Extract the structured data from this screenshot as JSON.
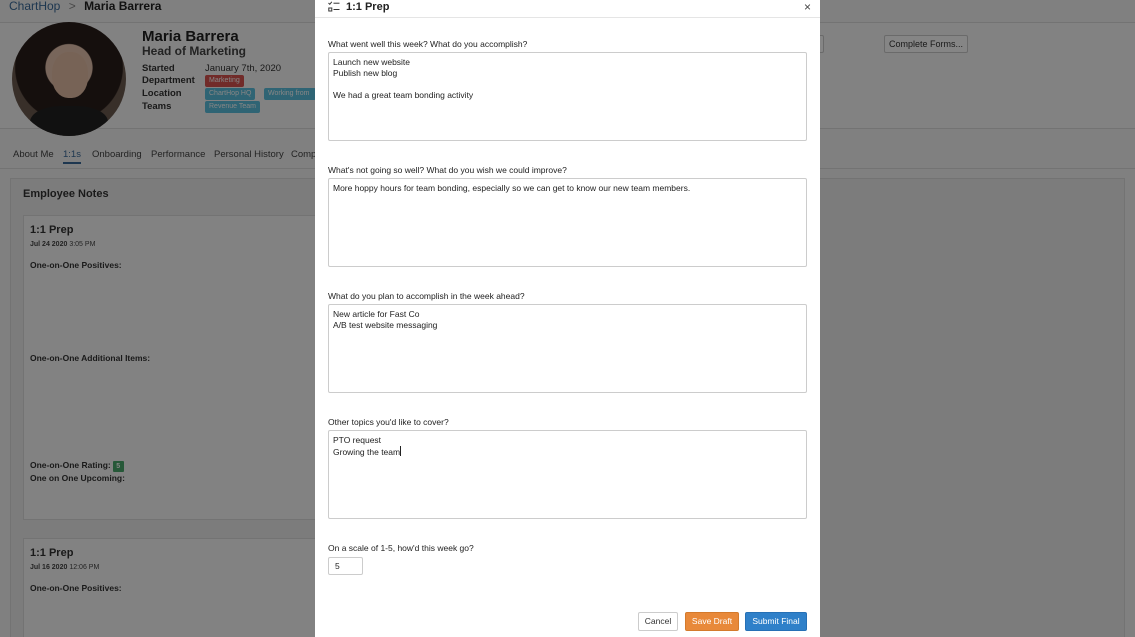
{
  "breadcrumb": {
    "app": "ChartHop",
    "separator": ">",
    "current": "Maria Barrera"
  },
  "profile": {
    "name": "Maria Barrera",
    "title": "Head of Marketing",
    "fields": [
      {
        "label": "Started",
        "value": "January 7th, 2020"
      },
      {
        "label": "Department"
      },
      {
        "label": "Location"
      },
      {
        "label": "Teams"
      }
    ],
    "department_chip": "Marketing",
    "location_chips": [
      "ChartHop HQ",
      "Working from"
    ],
    "teams_chip": "Revenue Team",
    "complete_forms_button": "Complete Forms..."
  },
  "tabs": [
    "About Me",
    "1:1s",
    "Onboarding",
    "Performance",
    "Personal History",
    "Comp"
  ],
  "active_tab": "1:1s",
  "notes": {
    "title": "Employee Notes",
    "cards": [
      {
        "title": "1:1 Prep",
        "date": "Jul 24 2020",
        "time": "3:05 PM",
        "positives_label": "One-on-One Positives:",
        "additional_label": "One-on-One Additional Items:",
        "rating_label": "One-on-One Rating:",
        "rating_value": "5",
        "upcoming_label": "One on One Upcoming:"
      },
      {
        "title": "1:1 Prep",
        "date": "Jul 16 2020",
        "time": "12:06 PM",
        "positives_label": "One-on-One Positives:"
      }
    ]
  },
  "modal": {
    "icon": "checklist-icon",
    "title": "1:1 Prep",
    "close_label": "×",
    "questions": [
      {
        "label": "What went well this week? What do you accomplish?",
        "value": "Launch new website\nPublish new blog\n\nWe had a great team bonding activity"
      },
      {
        "label": "What's not going so well? What do you wish we could improve?",
        "value": "More hoppy hours for team bonding, especially so we can get to know our new team members."
      },
      {
        "label": "What do you plan to accomplish in the week ahead?",
        "value": "New article for Fast Co\nA/B test website messaging"
      },
      {
        "label": "Other topics you'd like to cover?",
        "value": "PTO request\nGrowing the team"
      }
    ],
    "rating_question": "On a scale of 1-5, how'd this week go?",
    "rating_value": "5",
    "buttons": {
      "cancel": "Cancel",
      "save_draft": "Save Draft",
      "submit": "Submit Final"
    }
  },
  "colors": {
    "accent": "#2f80c9",
    "draft": "#e8893a",
    "department_chip": "#d9534f",
    "location_chip": "#5bc0de",
    "rating_badge": "#4aa96c"
  }
}
